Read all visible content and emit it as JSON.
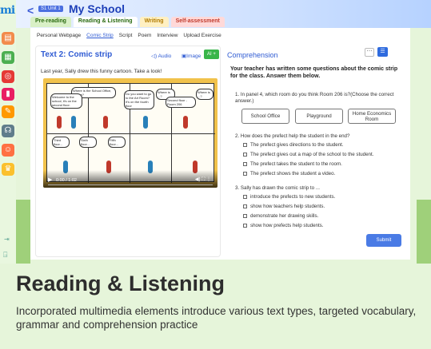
{
  "app": {
    "logo": "mi"
  },
  "header": {
    "back": "<",
    "unit_badge": "S1 Unit 1",
    "title": "My School"
  },
  "tabs": [
    "Pre-reading",
    "Reading & Listening",
    "Writing",
    "Self-assessment"
  ],
  "subnav": [
    "Personal Webpage",
    "Comic Strip",
    "Script",
    "Poem",
    "Interview",
    "Upload Exercise"
  ],
  "left": {
    "title": "Text 2: Comic strip",
    "audio": "Audio",
    "image": "Image",
    "ai": "AI +",
    "intro": "Last year, Sally drew this funny cartoon. Take a look!",
    "comic": {
      "b1": "Where is the School Office, please?",
      "b2": "Welcome to the school, it's on the second floor.",
      "b3": "Do you want to go to the Art Room? It's on the fourth floor",
      "b4": "Where is ...?",
      "b5": "Second floor - Room 206",
      "b6": "Where is ...?",
      "b7": "Third floor...",
      "b8": "Sixth floor...",
      "b9": "Fifth floor..."
    },
    "video_time": "0:00 / 1:02"
  },
  "right": {
    "heading": "Comprehension",
    "teacher": "Your teacher has written some questions about the comic strip for the class. Answer them below.",
    "q1": "1. In panel 4, which room do you think Room 206 is?(Choose the correct answer.)",
    "q1_opts": [
      "School Office",
      "Playground",
      "Home Economics Room"
    ],
    "q2": "2. How does the prefect help the student in the end?",
    "q2_opts": [
      "The prefect gives directions to the student.",
      "The prefect gives out a map of the school to the student.",
      "The prefect takes the student to the room.",
      "The prefect shows the student a video."
    ],
    "q3": "3. Sally has drawn the comic strip to ...",
    "q3_opts": [
      "introduce the prefects to new students.",
      "show how teachers help students.",
      "demonstrate her drawing skills.",
      "show how prefects help students."
    ],
    "submit": "Submit"
  },
  "footer": {
    "title": "Reading & Listening",
    "desc": "Incorporated multimedia elements introduce various text types, targeted vocabulary, grammar and comprehension practice"
  },
  "colors": {
    "accent": "#2f5bd3",
    "ai": "#39b54a",
    "bg": "#e6f5da"
  }
}
